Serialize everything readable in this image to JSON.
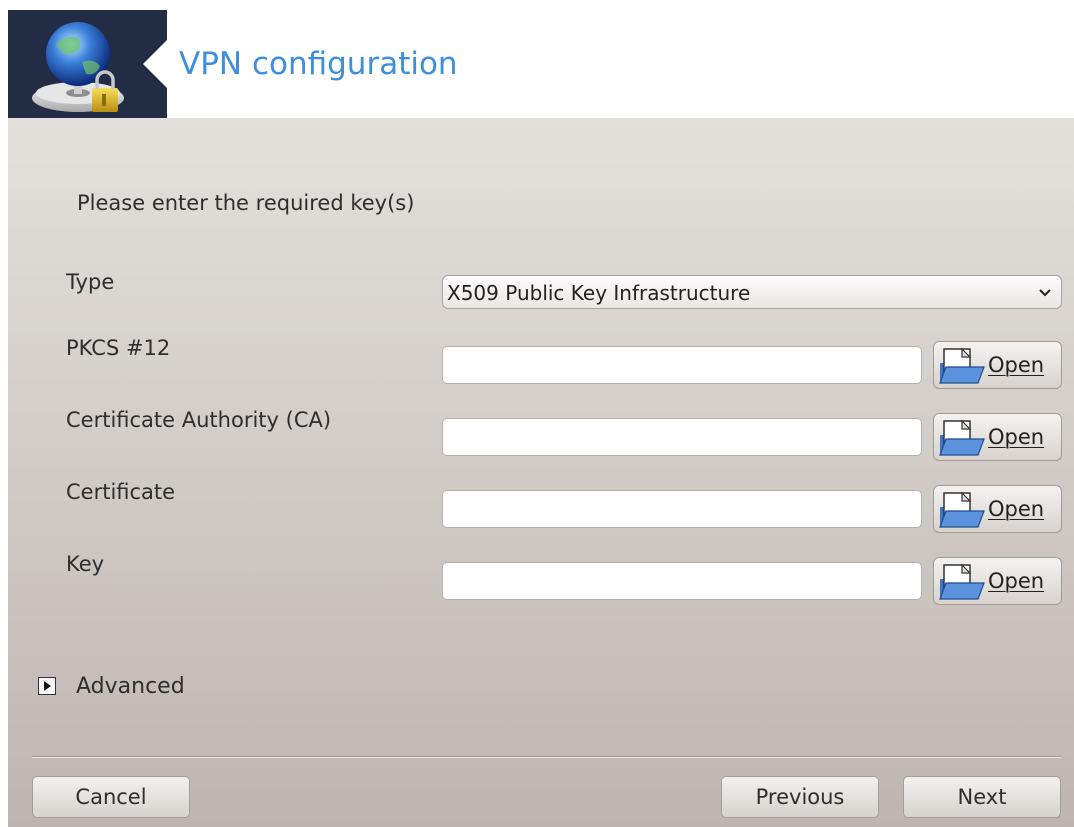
{
  "header": {
    "title": "VPN configuration",
    "logo_icon": "globe-network-lock-icon"
  },
  "form": {
    "intro": "Please enter the required key(s)",
    "type_label": "Type",
    "type_value": "X509 Public Key Infrastructure",
    "fields": [
      {
        "label": "PKCS #12",
        "value": "",
        "open_label": "Open"
      },
      {
        "label": "Certificate Authority (CA)",
        "value": "",
        "open_label": "Open"
      },
      {
        "label": "Certificate",
        "value": "",
        "open_label": "Open"
      },
      {
        "label": "Key",
        "value": "",
        "open_label": "Open"
      }
    ]
  },
  "advanced": {
    "label": "Advanced"
  },
  "buttons": {
    "cancel": "Cancel",
    "previous": "Previous",
    "next": "Next"
  },
  "colors": {
    "header_bg": "#232c45",
    "title": "#3d8fdc",
    "panel_top": "#e3e0dc",
    "panel_bottom": "#bdb5b1"
  }
}
